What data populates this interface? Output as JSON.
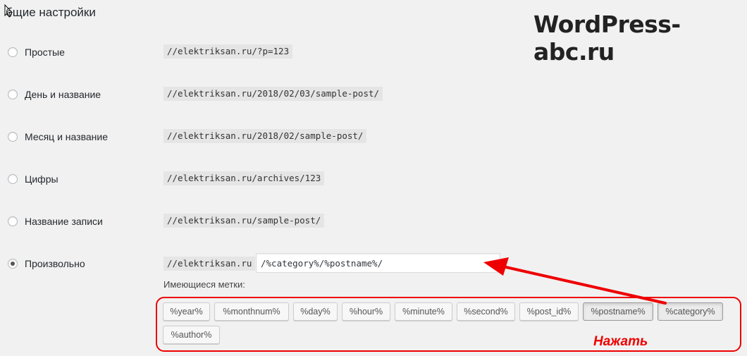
{
  "section": {
    "title": "бщие настройки"
  },
  "watermark": "WordPress-abc.ru",
  "options": [
    {
      "label": "Простые",
      "example": "//elektriksan.ru/?p=123",
      "checked": false
    },
    {
      "label": "День и название",
      "example": "//elektriksan.ru/2018/02/03/sample-post/",
      "checked": false
    },
    {
      "label": "Месяц и название",
      "example": "//elektriksan.ru/2018/02/sample-post/",
      "checked": false
    },
    {
      "label": "Цифры",
      "example": "//elektriksan.ru/archives/123",
      "checked": false
    },
    {
      "label": "Название записи",
      "example": "//elektriksan.ru/sample-post/",
      "checked": false
    },
    {
      "label": "Произвольно",
      "example": "//elektriksan.ru",
      "checked": true
    }
  ],
  "custom_structure": {
    "value": "/%category%/%postname%/"
  },
  "available_tags": {
    "label": "Имеющиеся метки:",
    "tags": [
      {
        "label": "%year%",
        "active": false
      },
      {
        "label": "%monthnum%",
        "active": false
      },
      {
        "label": "%day%",
        "active": false
      },
      {
        "label": "%hour%",
        "active": false
      },
      {
        "label": "%minute%",
        "active": false
      },
      {
        "label": "%second%",
        "active": false
      },
      {
        "label": "%post_id%",
        "active": false
      },
      {
        "label": "%postname%",
        "active": true
      },
      {
        "label": "%category%",
        "active": true
      },
      {
        "label": "%author%",
        "active": false
      }
    ]
  },
  "annotation": {
    "text": "Нажать",
    "color": "#e00000"
  }
}
